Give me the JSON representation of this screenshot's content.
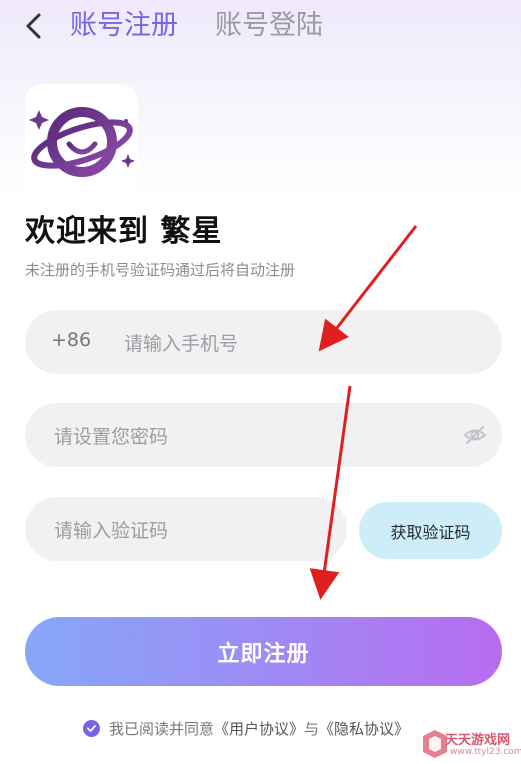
{
  "header": {
    "tab_register": "账号注册",
    "tab_login": "账号登陆"
  },
  "welcome": {
    "title": "欢迎来到 繁星",
    "subtitle": "未注册的手机号验证码通过后将自动注册"
  },
  "form": {
    "country_code": "+86",
    "phone_placeholder": "请输入手机号",
    "password_placeholder": "请设置您密码",
    "code_placeholder": "请输入验证码",
    "get_code_label": "获取验证码",
    "submit_label": "立即注册"
  },
  "agreement": {
    "prefix": "我已阅读并同意",
    "user_agreement": "《用户协议》",
    "connector": "与",
    "privacy_agreement": "《隐私协议》",
    "checked": true
  },
  "watermark": {
    "text": "天天游戏网",
    "url": "www.ttyl23.com"
  },
  "colors": {
    "accent": "#7a63e6",
    "button_start": "#86a7f8",
    "button_end": "#b86cf0",
    "code_button_bg": "#cdeef9",
    "arrow": "#e02020"
  }
}
